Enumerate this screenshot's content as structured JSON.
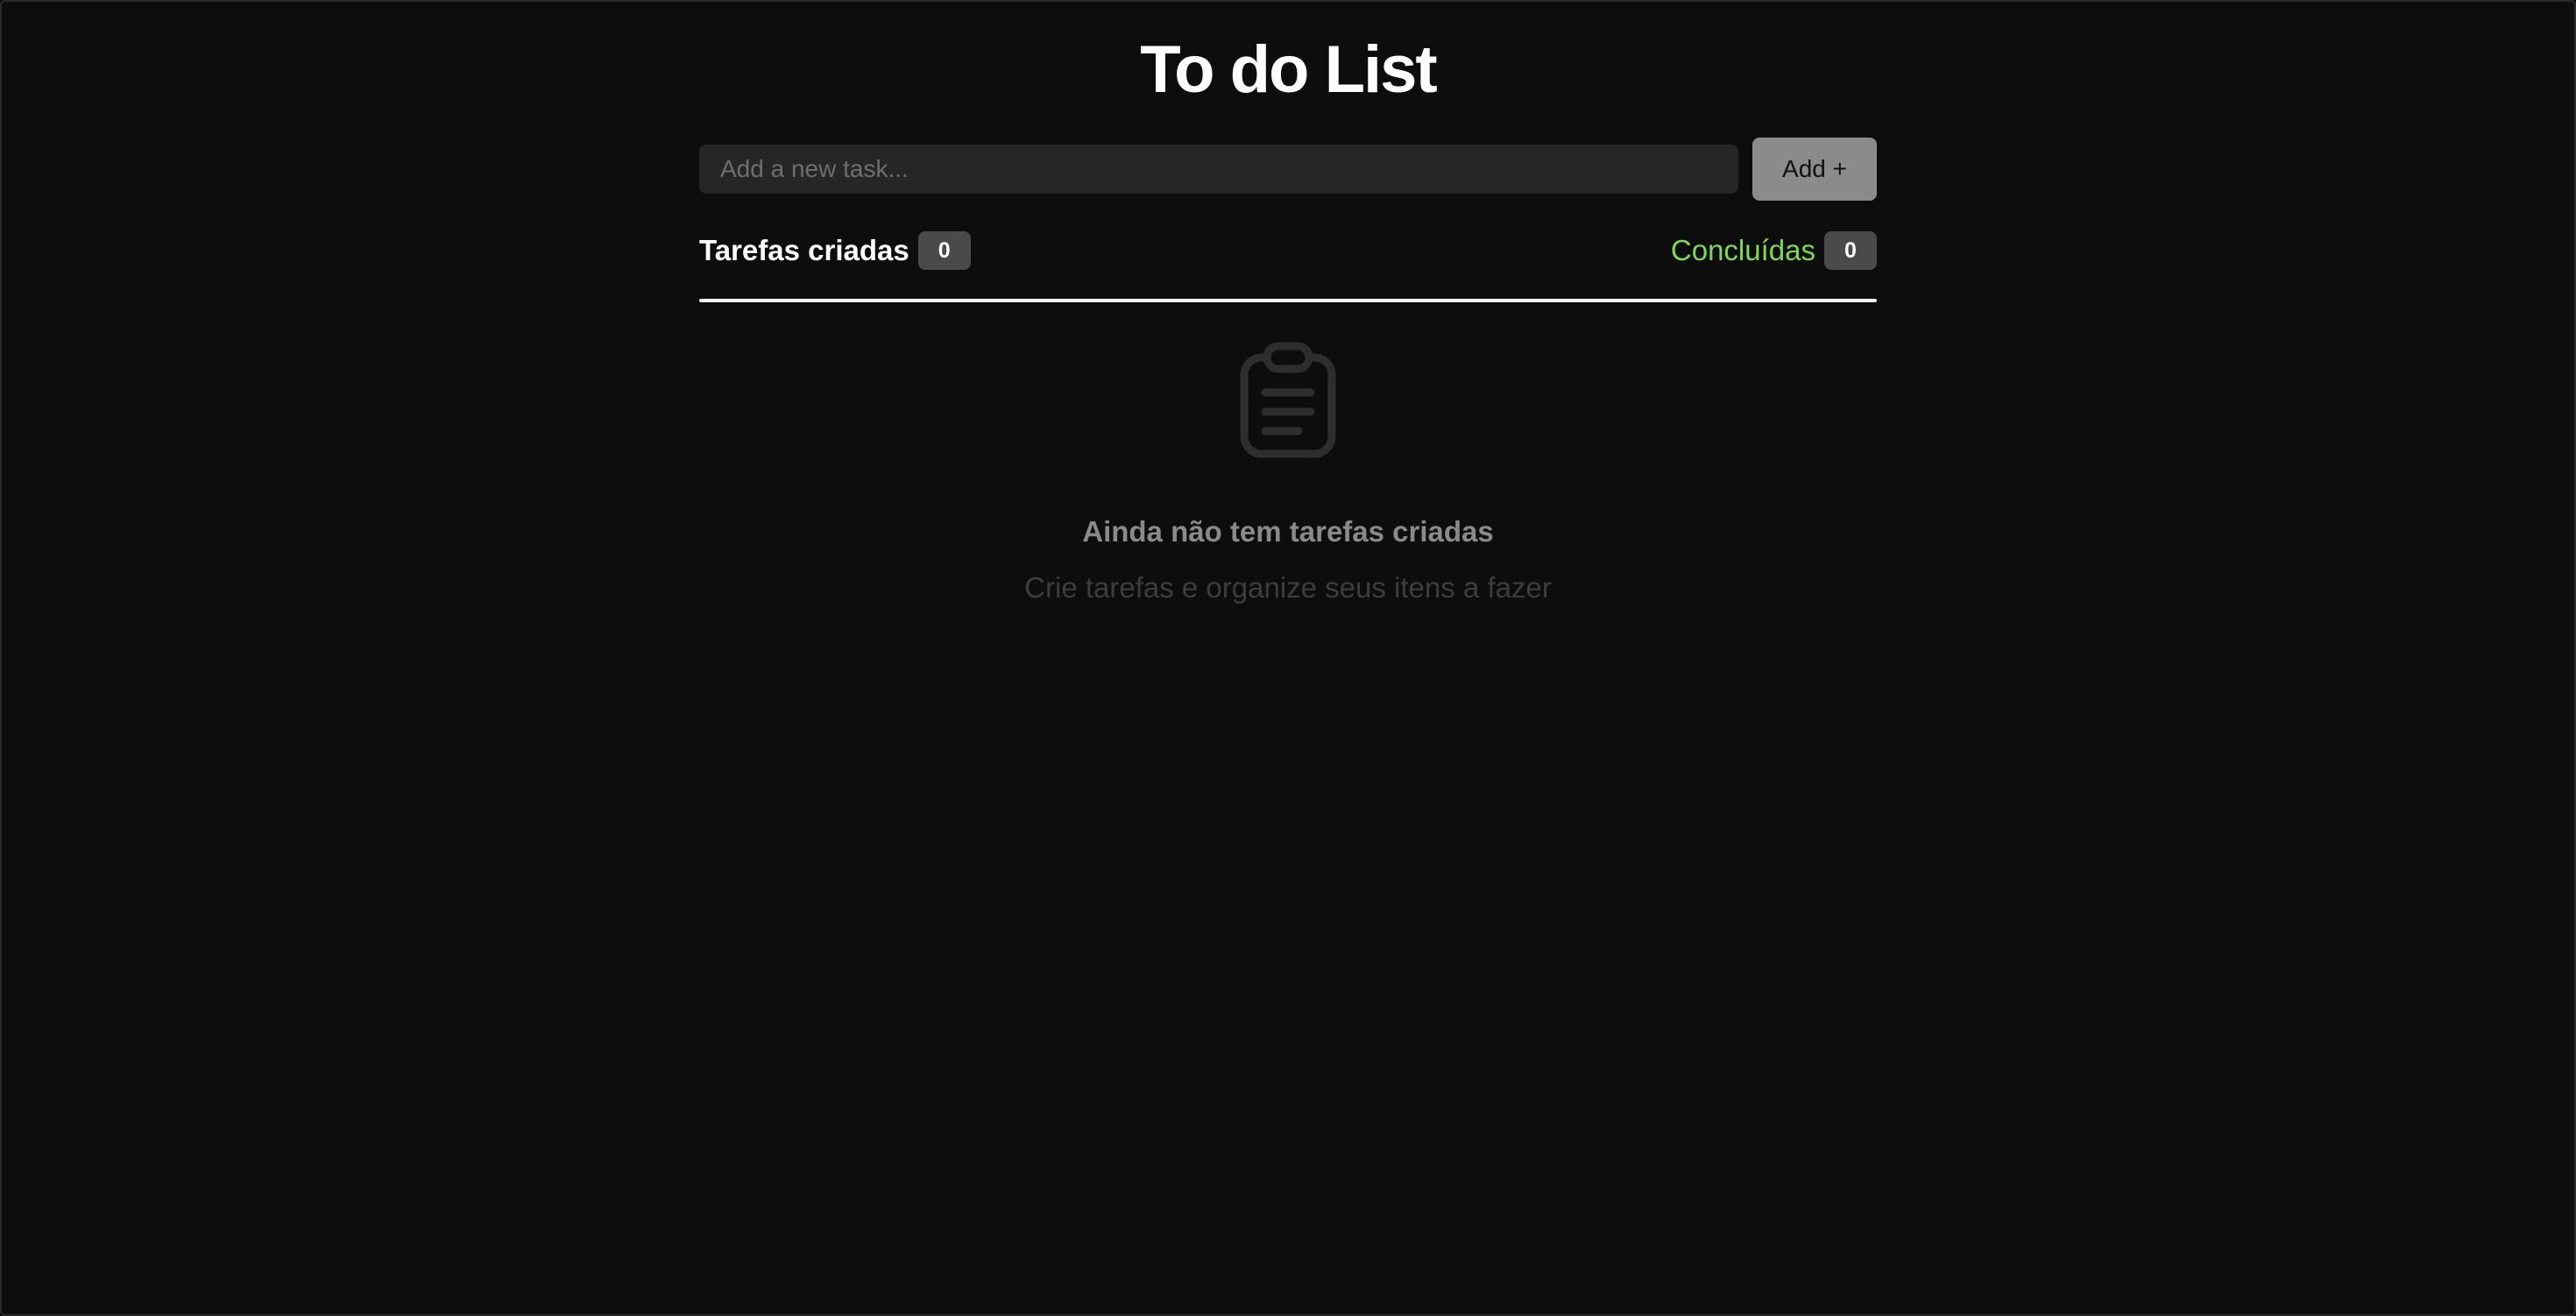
{
  "app": {
    "title": "To do List"
  },
  "new_task": {
    "placeholder": "Add a new task...",
    "value": "",
    "add_label": "Add +"
  },
  "stats": {
    "created_label": "Tarefas criadas",
    "created_count": "0",
    "done_label": "Concluídas",
    "done_count": "0"
  },
  "empty_state": {
    "icon": "clipboard-icon",
    "title": "Ainda não tem tarefas criadas",
    "subtitle": "Crie tarefas e organize seus itens a fazer"
  },
  "colors": {
    "background": "#0d0d0d",
    "accent_done": "#7ed957",
    "badge": "#4a4a4a",
    "button": "#8b8b8b"
  }
}
